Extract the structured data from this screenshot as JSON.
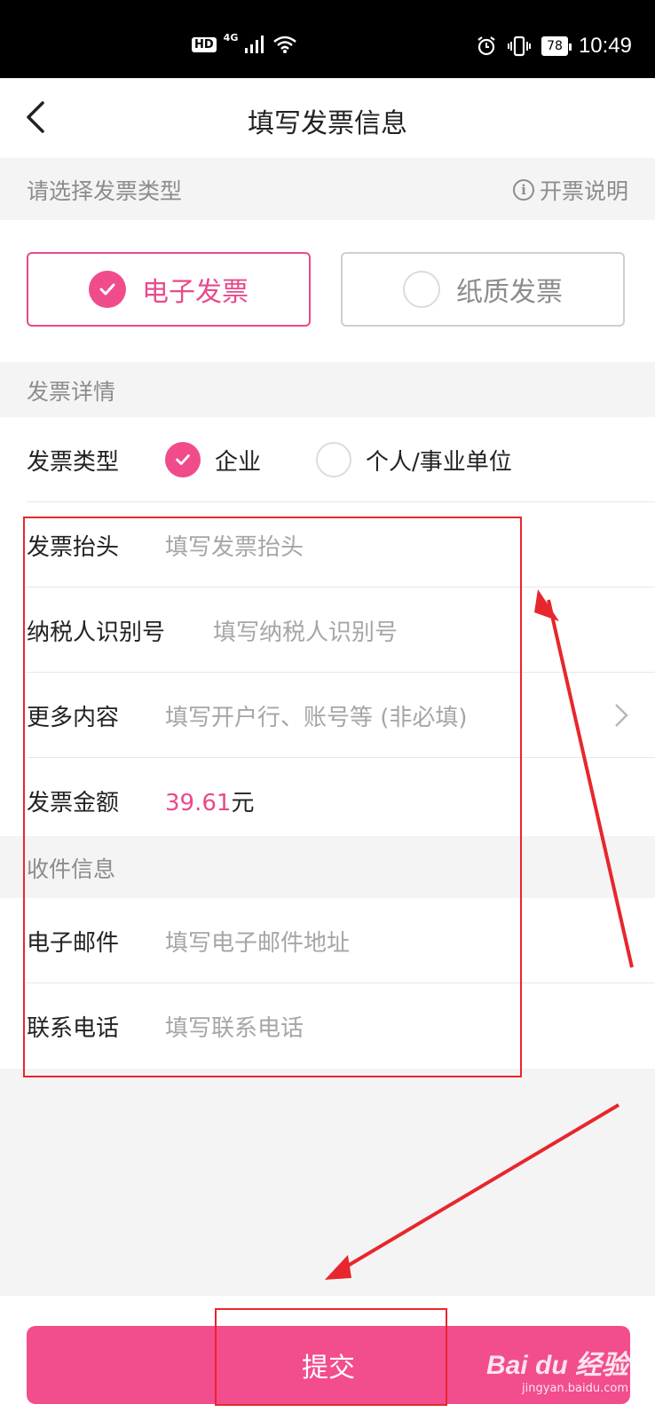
{
  "status_bar": {
    "hd_badge": "HD",
    "network": "4G",
    "battery": "78",
    "time": "10:49"
  },
  "nav": {
    "title": "填写发票信息"
  },
  "invoice_type_section": {
    "label": "请选择发票类型",
    "help_link": "开票说明",
    "options": [
      {
        "label": "电子发票",
        "selected": true
      },
      {
        "label": "纸质发票",
        "selected": false
      }
    ]
  },
  "details_section": {
    "label": "发票详情",
    "type_row": {
      "label": "发票类型",
      "options": [
        {
          "label": "企业",
          "selected": true
        },
        {
          "label": "个人/事业单位",
          "selected": false
        }
      ]
    },
    "title_row": {
      "label": "发票抬头",
      "placeholder": "填写发票抬头"
    },
    "tax_row": {
      "label": "纳税人识别号",
      "placeholder": "填写纳税人识别号"
    },
    "more_row": {
      "label": "更多内容",
      "placeholder": "填写开户行、账号等 (非必填)"
    },
    "amount_row": {
      "label": "发票金额",
      "amount": "39.61",
      "unit": "元"
    }
  },
  "receiver_section": {
    "label": "收件信息",
    "email_row": {
      "label": "电子邮件",
      "placeholder": "填写电子邮件地址"
    },
    "phone_row": {
      "label": "联系电话",
      "placeholder": "填写联系电话"
    }
  },
  "submit": {
    "label": "提交"
  },
  "watermark": {
    "brand": "Bai du 经验",
    "url": "jingyan.baidu.com"
  },
  "colors": {
    "accent": "#f24d8d",
    "annotation": "#e8262d"
  }
}
